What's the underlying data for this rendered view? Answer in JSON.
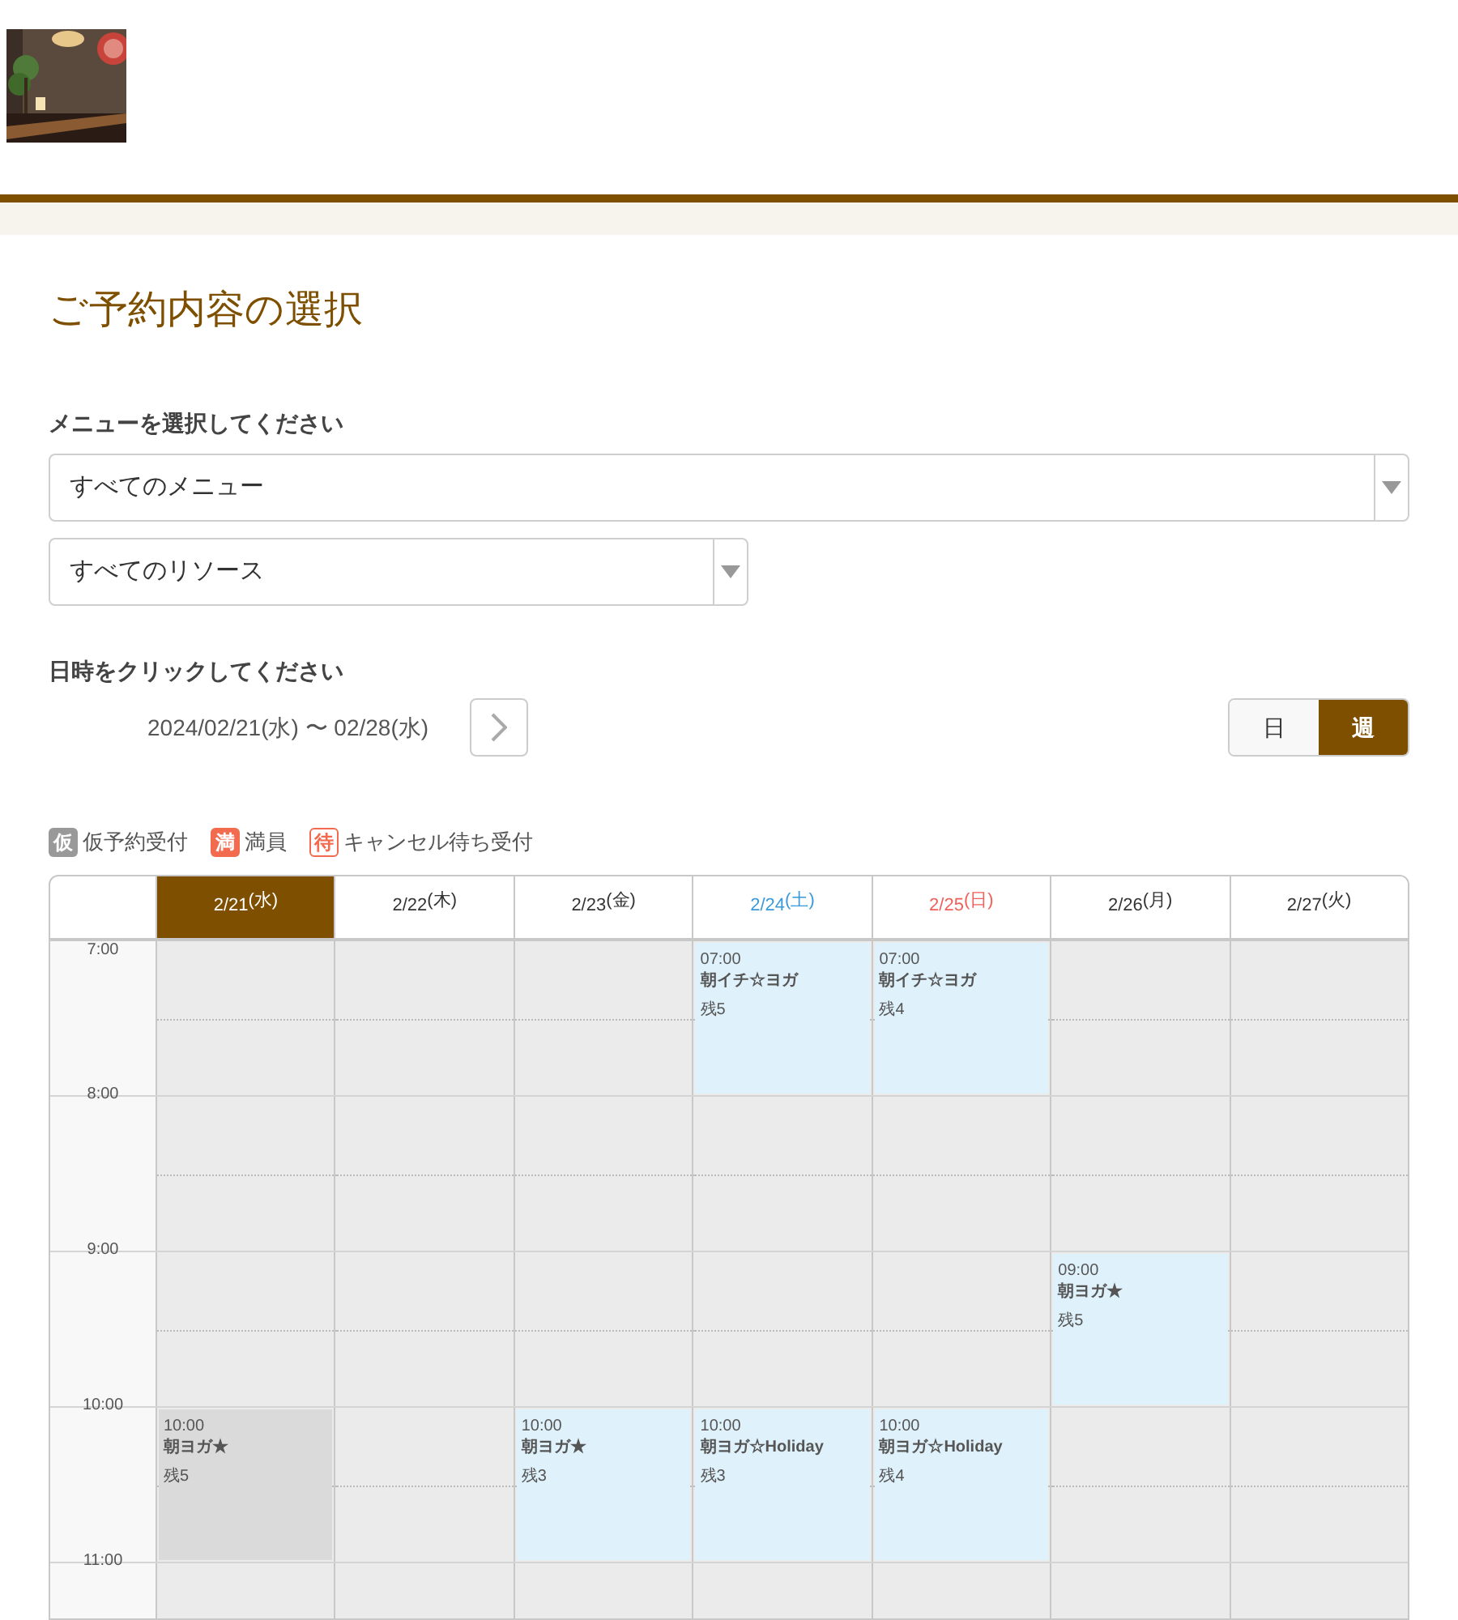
{
  "title": "ご予約内容の選択",
  "menu_label": "メニューを選択してください",
  "selects": [
    {
      "value": "すべてのメニュー",
      "wide": true
    },
    {
      "value": "すべてのリソース",
      "wide": false
    }
  ],
  "date_label": "日時をクリックしてください",
  "date_range": "2024/02/21(水) 〜 02/28(水)",
  "view_toggle": [
    {
      "label": "日",
      "selected": false
    },
    {
      "label": "週",
      "selected": true
    }
  ],
  "legend": [
    {
      "kind": "gray",
      "badge": "仮",
      "label": "仮予約受付"
    },
    {
      "kind": "full",
      "badge": "満",
      "label": "満員"
    },
    {
      "kind": "wait",
      "badge": "待",
      "label": "キャンセル待ち受付"
    }
  ],
  "days": [
    {
      "date": "2/21",
      "weekday": "(水)",
      "selected": true,
      "color": "#ffffff"
    },
    {
      "date": "2/22",
      "weekday": "(木)",
      "selected": false,
      "color": "#333333"
    },
    {
      "date": "2/23",
      "weekday": "(金)",
      "selected": false,
      "color": "#333333"
    },
    {
      "date": "2/24",
      "weekday": "(土)",
      "selected": false,
      "color": "#3a9ad9"
    },
    {
      "date": "2/25",
      "weekday": "(日)",
      "selected": false,
      "color": "#f0605a"
    },
    {
      "date": "2/26",
      "weekday": "(月)",
      "selected": false,
      "color": "#333333"
    },
    {
      "date": "2/27",
      "weekday": "(火)",
      "selected": false,
      "color": "#333333"
    }
  ],
  "hours": [
    {
      "label": "7:00",
      "cells": [
        null,
        null,
        null,
        {
          "kind": "open",
          "time": "07:00",
          "name": "朝イチ☆ヨガ",
          "remaining": "残5"
        },
        {
          "kind": "open",
          "time": "07:00",
          "name": "朝イチ☆ヨガ",
          "remaining": "残4"
        },
        null,
        null
      ]
    },
    {
      "label": "8:00",
      "cells": [
        null,
        null,
        null,
        null,
        null,
        null,
        null
      ]
    },
    {
      "label": "9:00",
      "cells": [
        null,
        null,
        null,
        null,
        null,
        {
          "kind": "open",
          "time": "09:00",
          "name": "朝ヨガ★",
          "remaining": "残5"
        },
        null
      ]
    },
    {
      "label": "10:00",
      "cells": [
        {
          "kind": "closed",
          "time": "10:00",
          "name": "朝ヨガ★",
          "remaining": "残5"
        },
        null,
        {
          "kind": "open",
          "time": "10:00",
          "name": "朝ヨガ★",
          "remaining": "残3"
        },
        {
          "kind": "open",
          "time": "10:00",
          "name": "朝ヨガ☆Holiday",
          "remaining": "残3"
        },
        {
          "kind": "open",
          "time": "10:00",
          "name": "朝ヨガ☆Holiday",
          "remaining": "残4"
        },
        null,
        null
      ]
    },
    {
      "label": "11:00",
      "cells": [
        null,
        null,
        null,
        null,
        null,
        null,
        null
      ]
    }
  ]
}
